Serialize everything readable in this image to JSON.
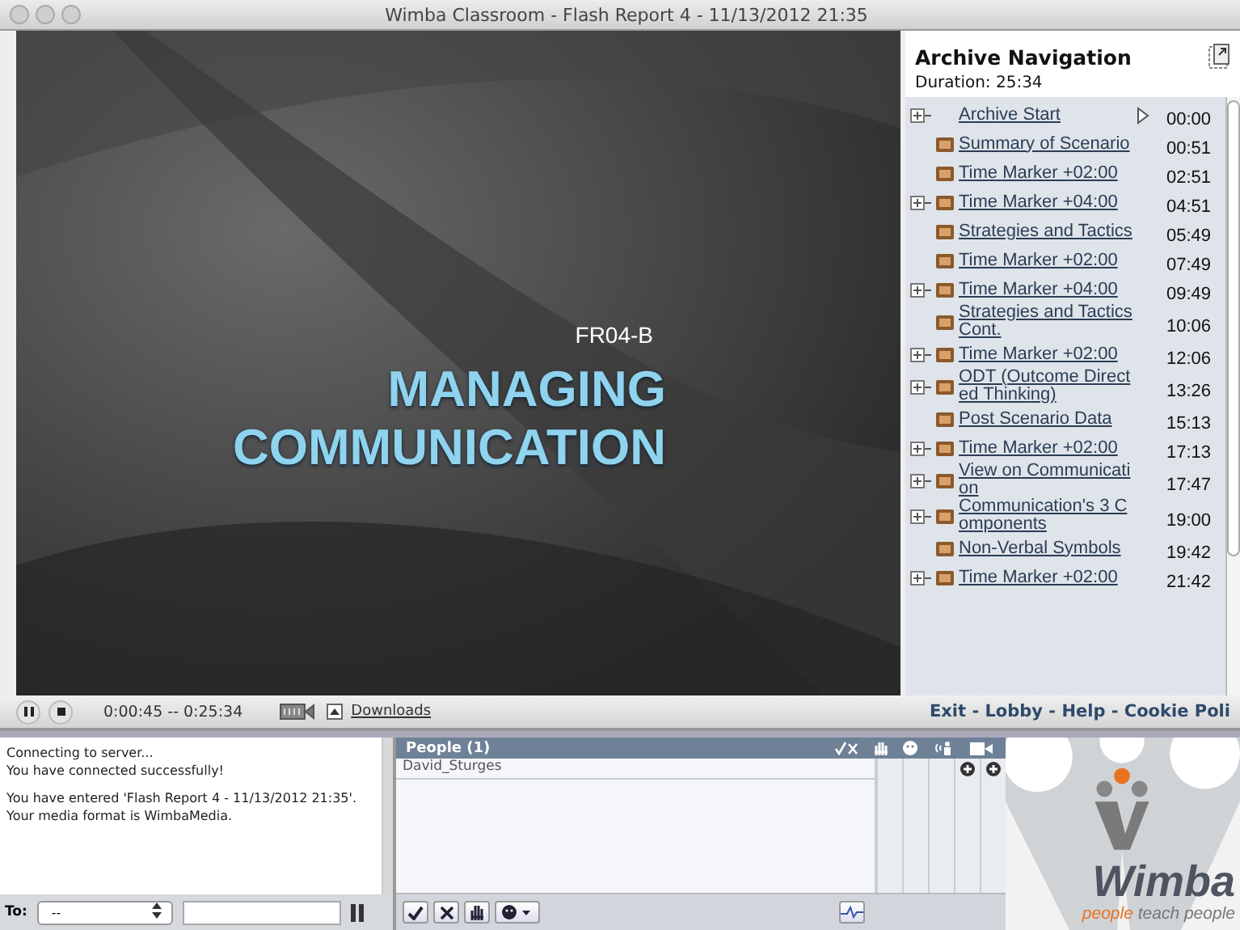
{
  "window": {
    "title": "Wimba Classroom - Flash Report 4 - 11/13/2012 21:35"
  },
  "slide": {
    "code": "FR04-B",
    "title_lines": [
      "MANAGING",
      "COMMUNICATION"
    ]
  },
  "navigation": {
    "title": "Archive Navigation",
    "duration": "Duration: 25:34",
    "items": [
      {
        "kind": "start",
        "label": "Archive Start",
        "time": "00:00",
        "expandable": true,
        "current": true
      },
      {
        "kind": "marker",
        "label": "Summary of Scenario",
        "time": "00:51",
        "expandable": false,
        "current": false
      },
      {
        "kind": "marker",
        "label": "Time Marker +02:00",
        "time": "02:51",
        "expandable": false,
        "current": false
      },
      {
        "kind": "marker",
        "label": "Time Marker +04:00",
        "time": "04:51",
        "expandable": true,
        "current": false
      },
      {
        "kind": "marker",
        "label": "Strategies and Tactics",
        "time": "05:49",
        "expandable": false,
        "current": false
      },
      {
        "kind": "marker",
        "label": "Time Marker +02:00",
        "time": "07:49",
        "expandable": false,
        "current": false
      },
      {
        "kind": "marker",
        "label": "Time Marker +04:00",
        "time": "09:49",
        "expandable": true,
        "current": false
      },
      {
        "kind": "marker",
        "label": "Strategies and Tactics Cont.",
        "time": "10:06",
        "expandable": false,
        "current": false
      },
      {
        "kind": "marker",
        "label": "Time Marker +02:00",
        "time": "12:06",
        "expandable": true,
        "current": false
      },
      {
        "kind": "marker",
        "label": "ODT (Outcome Directed Thinking)",
        "time": "13:26",
        "expandable": true,
        "current": false
      },
      {
        "kind": "marker",
        "label": "Post Scenario Data",
        "time": "15:13",
        "expandable": false,
        "current": false
      },
      {
        "kind": "marker",
        "label": "Time Marker +02:00",
        "time": "17:13",
        "expandable": true,
        "current": false
      },
      {
        "kind": "marker",
        "label": "View on Communication",
        "time": "17:47",
        "expandable": true,
        "current": false
      },
      {
        "kind": "marker",
        "label": "Communication's 3 Components",
        "time": "19:00",
        "expandable": true,
        "current": false
      },
      {
        "kind": "marker",
        "label": "Non-Verbal Symbols",
        "time": "19:42",
        "expandable": false,
        "current": false
      },
      {
        "kind": "marker",
        "label": "Time Marker +02:00",
        "time": "21:42",
        "expandable": true,
        "current": false
      }
    ]
  },
  "player": {
    "time": "0:00:45 -- 0:25:34",
    "downloads": "Downloads",
    "links": [
      "Exit",
      "Lobby",
      "Help",
      "Cookie Poli"
    ],
    "separator": " - "
  },
  "chat": {
    "messages": [
      [
        "Connecting to server...",
        "You have connected successfully!"
      ],
      [
        "You have entered 'Flash Report 4 - 11/13/2012 21:35'.",
        "Your media format is WimbaMedia."
      ]
    ],
    "to_label": "To:",
    "to_value": "--"
  },
  "people": {
    "title": "People (1)",
    "names": [
      "David_Sturges"
    ]
  },
  "logo": {
    "brand": "Wimba",
    "tagline_lead": "people",
    "tagline_rest": "teach people"
  }
}
